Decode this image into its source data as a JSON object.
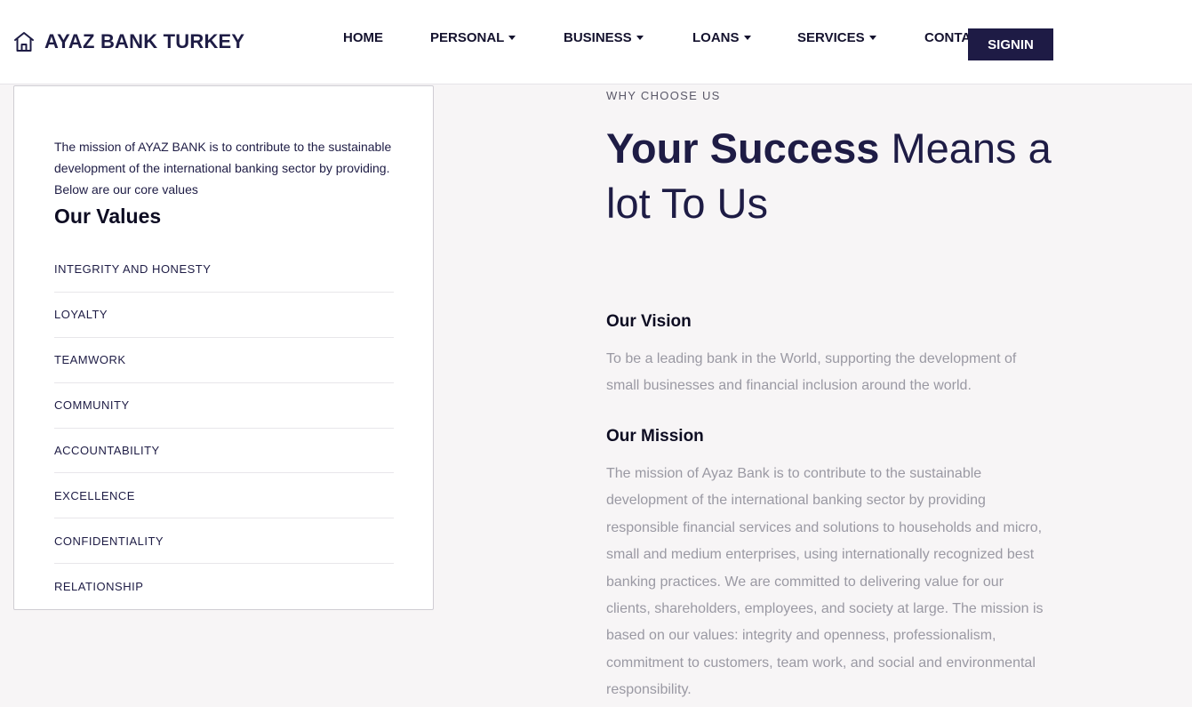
{
  "header": {
    "brand_name": "AYAZ BANK TURKEY",
    "brand_icon": "home-icon",
    "nav": [
      {
        "label": "HOME",
        "has_dropdown": false
      },
      {
        "label": "PERSONAL",
        "has_dropdown": true
      },
      {
        "label": "BUSINESS",
        "has_dropdown": true
      },
      {
        "label": "LOANS",
        "has_dropdown": true
      },
      {
        "label": "SERVICES",
        "has_dropdown": true
      },
      {
        "label": "CONTA",
        "has_dropdown": false
      }
    ],
    "signin_label": "SIGNIN"
  },
  "values_card": {
    "intro": "The mission of AYAZ BANK is to contribute to the sustainable development of the international banking sector by providing. Below are our core values",
    "heading": "Our Values",
    "items": [
      "INTEGRITY AND HONESTY",
      "LOYALTY",
      "TEAMWORK",
      "COMMUNITY",
      "ACCOUNTABILITY",
      "EXCELLENCE",
      "CONFIDENTIALITY",
      "RELATIONSHIP"
    ]
  },
  "why": {
    "eyebrow": "WHY CHOOSE US",
    "title_strong": "Your Success",
    "title_rest": " Means a lot To Us",
    "vision_title": "Our Vision",
    "vision_text": "To be a leading bank in the World, supporting the development of small businesses and financial inclusion around the world.",
    "mission_title": "Our Mission",
    "mission_text": "The mission of Ayaz Bank is to contribute to the sustainable development of the international banking sector by providing responsible financial services and solutions to households and micro, small and medium enterprises, using internationally recognized best banking practices. We are committed to delivering value for our clients, shareholders, employees, and society at large. The mission is based on our values: integrity and openness, professionalism, commitment to customers, team work, and social and environmental responsibility."
  },
  "colors": {
    "brand": "#1e1b45",
    "background": "#f7f5f6",
    "muted_text": "#9a99a3"
  }
}
